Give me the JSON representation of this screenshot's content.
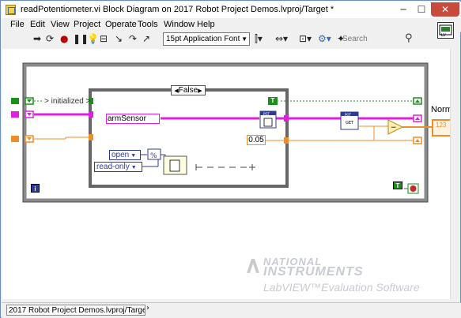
{
  "window": {
    "title": "readPotentiometer.vi Block Diagram on 2017 Robot Project Demos.lvproj/Target *",
    "minimize": "─",
    "maximize": "☐",
    "close": "✕"
  },
  "menu": [
    "File",
    "Edit",
    "View",
    "Project",
    "Operate",
    "Tools",
    "Window",
    "Help"
  ],
  "toolbar": {
    "font_select": "15pt Application Font",
    "search_placeholder": "Search"
  },
  "diagram": {
    "case_selector": "False",
    "feedback_label": "> initialized >",
    "arm_sensor": "armSensor",
    "constant_value": "0.05",
    "open_label": "open",
    "readonly_label": "read-only",
    "pot_label_1": "POT",
    "pot_label_2": "POT",
    "pot_get": "GET",
    "true_const_1": "T",
    "true_const_2": "T",
    "info_icon": "i",
    "indicator_label_partial": "Norm",
    "indicator_value": "123",
    "true_const_3": "T"
  },
  "watermark": {
    "line1": "NATIONAL",
    "line2": "INSTRUMENTS",
    "line3": "LabVIEW™Evaluation Software"
  },
  "status": {
    "target": "2017 Robot Project Demos.lvproj/Target"
  },
  "colors": {
    "boolean_wire": "#1a8f1a",
    "cluster_wire": "#e020e0",
    "numeric_wire": "#f28c28",
    "enum_wire": "#2d3a9a"
  }
}
